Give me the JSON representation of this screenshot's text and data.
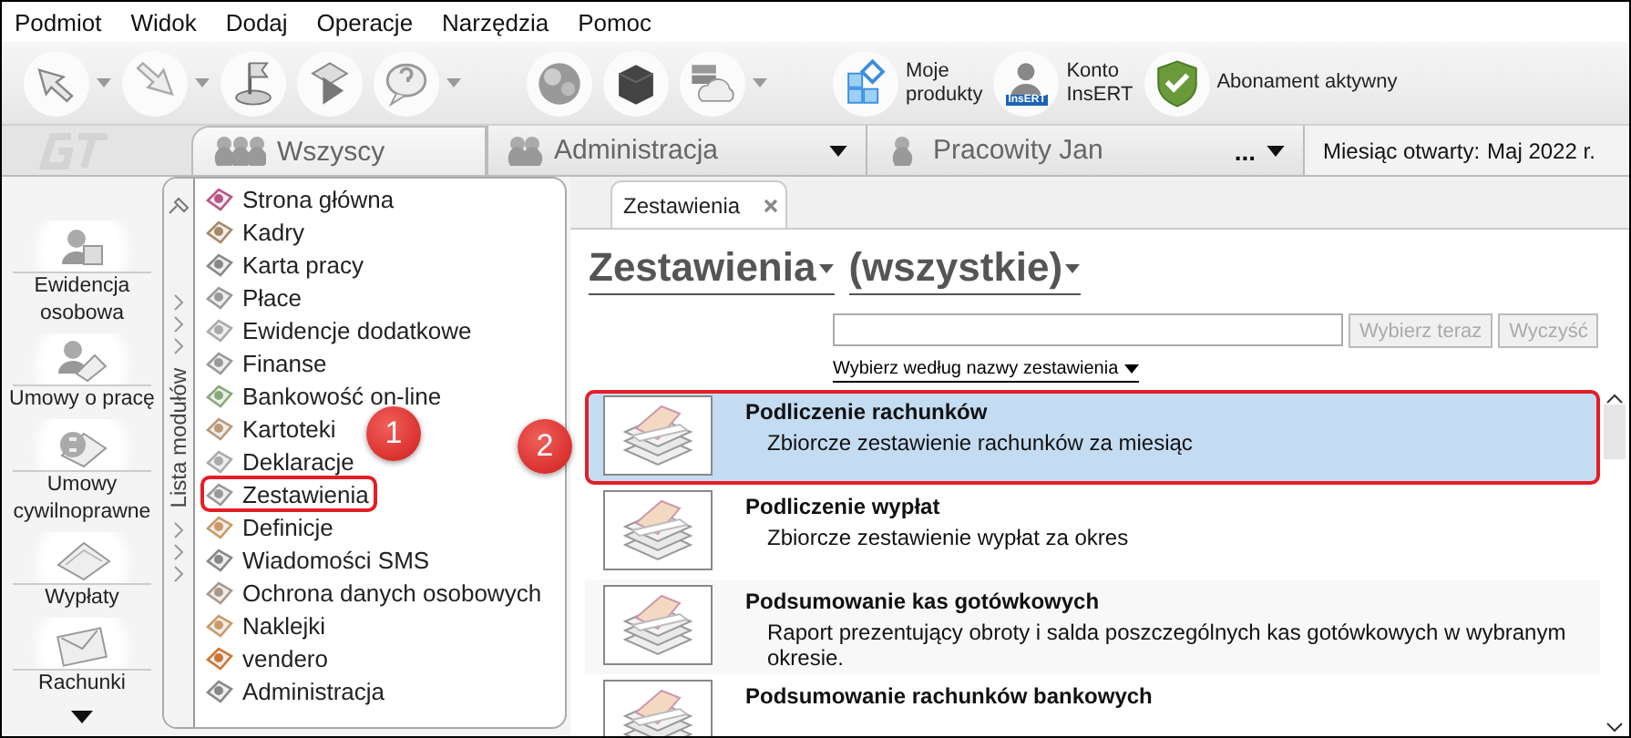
{
  "menu": [
    "Podmiot",
    "Widok",
    "Dodaj",
    "Operacje",
    "Narzędzia",
    "Pomoc"
  ],
  "toolbar": [
    {
      "dropdown": true
    },
    {
      "dropdown": true
    },
    {
      "dropdown": false
    },
    {
      "dropdown": false
    },
    {
      "dropdown": true
    },
    {
      "dropdown": false
    },
    {
      "dropdown": false
    },
    {
      "dropdown": true
    },
    {
      "dropdown": false,
      "label_lines": [
        "Moje",
        "produkty"
      ]
    },
    {
      "dropdown": false,
      "badge": "InsERT",
      "label_lines": [
        "Konto",
        "InsERT"
      ]
    },
    {
      "dropdown": false,
      "label_lines": [
        "Abonament aktywny"
      ]
    }
  ],
  "filter_tabs": [
    {
      "label": "Wszyscy",
      "selected": true,
      "dropdown": false
    },
    {
      "label": "Administracja",
      "selected": false,
      "dropdown": true
    },
    {
      "label": "Pracowity Jan",
      "selected": false,
      "dropdown": true,
      "more": "..."
    }
  ],
  "month": {
    "label": "Miesiąc otwarty:",
    "value": "Maj 2022 r."
  },
  "nav": [
    {
      "label": "Ewidencja osobowa"
    },
    {
      "label": "Umowy o pracę"
    },
    {
      "label": "Umowy cywilnoprawne"
    },
    {
      "label": "Wypłaty"
    },
    {
      "label": "Rachunki"
    }
  ],
  "modules": {
    "title": "Lista modułów",
    "items": [
      {
        "label": "Strona główna",
        "highlighted": false
      },
      {
        "label": "Kadry",
        "highlighted": false
      },
      {
        "label": "Karta pracy",
        "highlighted": false
      },
      {
        "label": "Płace",
        "highlighted": false
      },
      {
        "label": "Ewidencje dodatkowe",
        "highlighted": false
      },
      {
        "label": "Finanse",
        "highlighted": false
      },
      {
        "label": "Bankowość on-line",
        "highlighted": false
      },
      {
        "label": "Kartoteki",
        "highlighted": false
      },
      {
        "label": "Deklaracje",
        "highlighted": false
      },
      {
        "label": "Zestawienia",
        "highlighted": true
      },
      {
        "label": "Definicje",
        "highlighted": false
      },
      {
        "label": "Wiadomości SMS",
        "highlighted": false
      },
      {
        "label": "Ochrona danych osobowych",
        "highlighted": false
      },
      {
        "label": "Naklejki",
        "highlighted": false
      },
      {
        "label": "vendero",
        "highlighted": false
      },
      {
        "label": "Administracja",
        "highlighted": false
      }
    ]
  },
  "doc_tab": {
    "label": "Zestawienia"
  },
  "heading": {
    "category": "Zestawienia",
    "filter": "(wszystkie)"
  },
  "search": {
    "buttons": [
      {
        "label": "Wybierz teraz",
        "disabled": true
      },
      {
        "label": "Wyczyść",
        "disabled": true
      }
    ],
    "mode": "Wybierz według nazwy zestawienia"
  },
  "reports": [
    {
      "title": "Podliczenie rachunków",
      "description": "Zbiorcze zestawienie rachunków za miesiąc",
      "selected": true,
      "highlighted": true
    },
    {
      "title": "Podliczenie wypłat",
      "description": "Zbiorcze zestawienie wypłat za okres",
      "selected": false,
      "highlighted": false
    },
    {
      "title": "Podsumowanie kas gotówkowych",
      "description": "Raport prezentujący obroty i salda poszczególnych kas gotówkowych w wybranym okresie.",
      "selected": false,
      "highlighted": false
    },
    {
      "title": "Podsumowanie rachunków bankowych",
      "selected": false,
      "highlighted": false
    }
  ],
  "callouts": [
    {
      "label": "1"
    },
    {
      "label": "2"
    }
  ]
}
